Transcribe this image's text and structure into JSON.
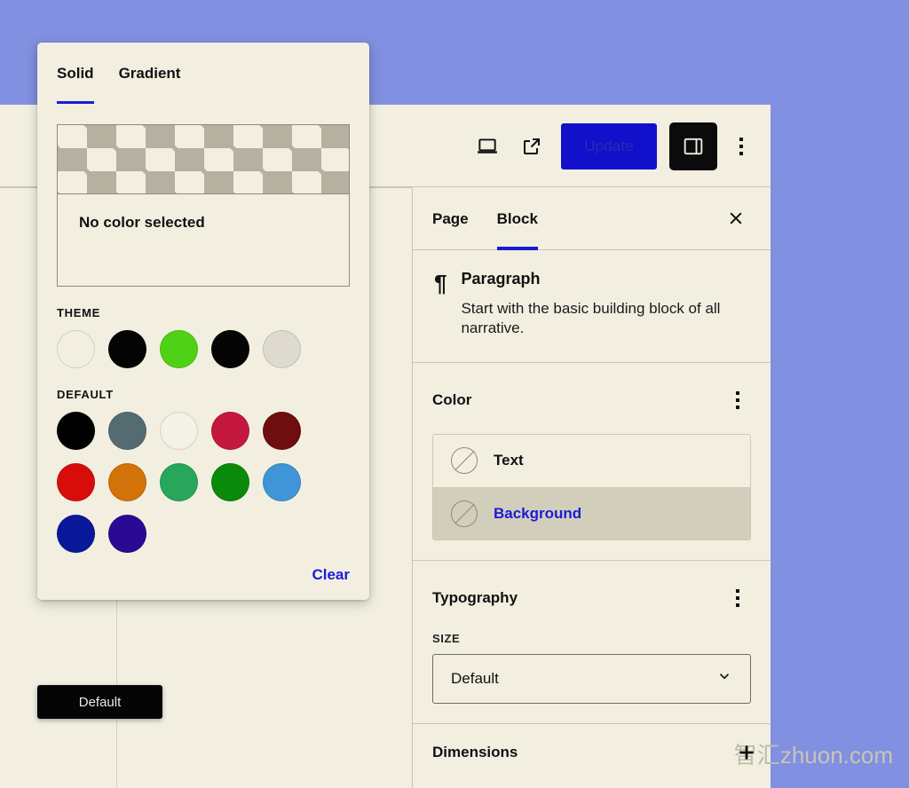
{
  "background_color": "#8190e0",
  "editor": {
    "toolbar": {
      "preview_icon": "laptop-preview-icon",
      "external_icon": "external-link-icon",
      "update_label": "Update",
      "sidebar_toggle_icon": "sidebar-toggle-icon",
      "more_icon": "ellipsis-vertical-icon"
    }
  },
  "sidebar": {
    "tabs": [
      {
        "label": "Page",
        "active": false
      },
      {
        "label": "Block",
        "active": true
      }
    ],
    "close_icon": "close-icon",
    "block": {
      "icon": "paragraph-pilcrow-icon",
      "title": "Paragraph",
      "description": "Start with the basic building block of all narrative."
    },
    "color_section": {
      "title": "Color",
      "more_icon": "ellipsis-vertical-icon",
      "rows": [
        {
          "label": "Text",
          "selected": false,
          "swatch": "none-selected-icon"
        },
        {
          "label": "Background",
          "selected": true,
          "swatch": "none-selected-icon"
        }
      ]
    },
    "typography_section": {
      "title": "Typography",
      "more_icon": "ellipsis-vertical-icon",
      "size_label": "SIZE",
      "size_value": "Default",
      "chevron_icon": "chevron-down-icon"
    },
    "dimensions_section": {
      "title": "Dimensions",
      "add_icon": "plus-icon"
    }
  },
  "color_popover": {
    "tabs": [
      {
        "label": "Solid",
        "active": true
      },
      {
        "label": "Gradient",
        "active": false
      }
    ],
    "preview_state": "No color selected",
    "theme_label": "THEME",
    "theme_colors": [
      "#f2efe1",
      "#040404",
      "#4fd216",
      "#050505",
      "#dedad0"
    ],
    "default_label": "DEFAULT",
    "default_colors": [
      "#000000",
      "#556b72",
      "#f4f1e6",
      "#c5183f",
      "#6e0e0e",
      "#d90c0c",
      "#d4720a",
      "#28a65c",
      "#0a8a0a",
      "#3f95d8",
      "#0a189a",
      "#2a0a94"
    ],
    "clear_label": "Clear"
  },
  "tooltip": {
    "label": "Default"
  },
  "watermark": {
    "cn": "智汇",
    "en": "zhuon.com"
  }
}
